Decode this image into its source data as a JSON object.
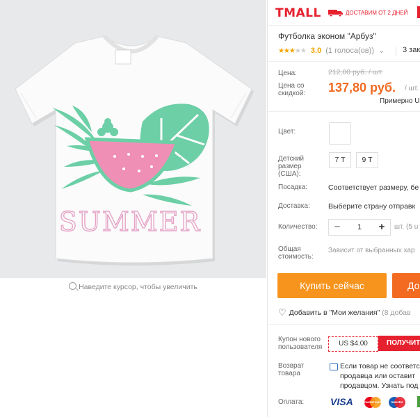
{
  "gallery": {
    "zoom_hint": "Наведите курсор, чтобы увеличить",
    "tshirt_print_text": "SUMMER"
  },
  "header": {
    "brand": "TMALL",
    "delivery_text": "ДОСТАВИМ ОТ 2 ДНЕЙ",
    "brand_color": "#e6212f"
  },
  "product": {
    "title": "Футболка эконом \"Арбуз\"",
    "rating_stars": 3,
    "rating_score": "3.0",
    "rating_count": "(1 голоса(ов))",
    "orders_text": "3 зак"
  },
  "price": {
    "label": "Цена:",
    "old_value": "212,00 руб. / шт.",
    "discount_label": "Цена со скидкой:",
    "new_value": "137,80 руб.",
    "unit": "/ шт.",
    "approx": "Примерно U"
  },
  "options": {
    "color_label": "Цвет:",
    "size_label": "Детский размер (США):",
    "sizes": [
      "7 T",
      "9 T"
    ],
    "fit_label": "Посадка:",
    "fit_value": "Соответствует размеру, бе",
    "shipping_label": "Доставка:",
    "shipping_value": "Выберите страну отправк"
  },
  "quantity": {
    "label": "Количество:",
    "minus": "−",
    "value": "1",
    "plus": "+",
    "unit": "шт. (5 u"
  },
  "total": {
    "label": "Общая стоимость:",
    "value": "Зависит от выбранных хар"
  },
  "actions": {
    "buy_now": "Купить сейчас",
    "add_to_cart": "До",
    "wishlist": "Добавить в \"Мои желания\"",
    "wishlist_count": "(8 добав"
  },
  "coupon": {
    "label": "Купон нового пользователя",
    "value": "US $4.00",
    "button": "ПОЛУЧИТ"
  },
  "returns": {
    "label": "Возврат товара",
    "lines": [
      "Если товар не соответс",
      "продавца или оставит",
      "продавцом. Узнать под"
    ]
  },
  "payment": {
    "label": "Оплата:",
    "methods": [
      "VISA",
      "mastercard",
      "maestro",
      "M"
    ]
  }
}
